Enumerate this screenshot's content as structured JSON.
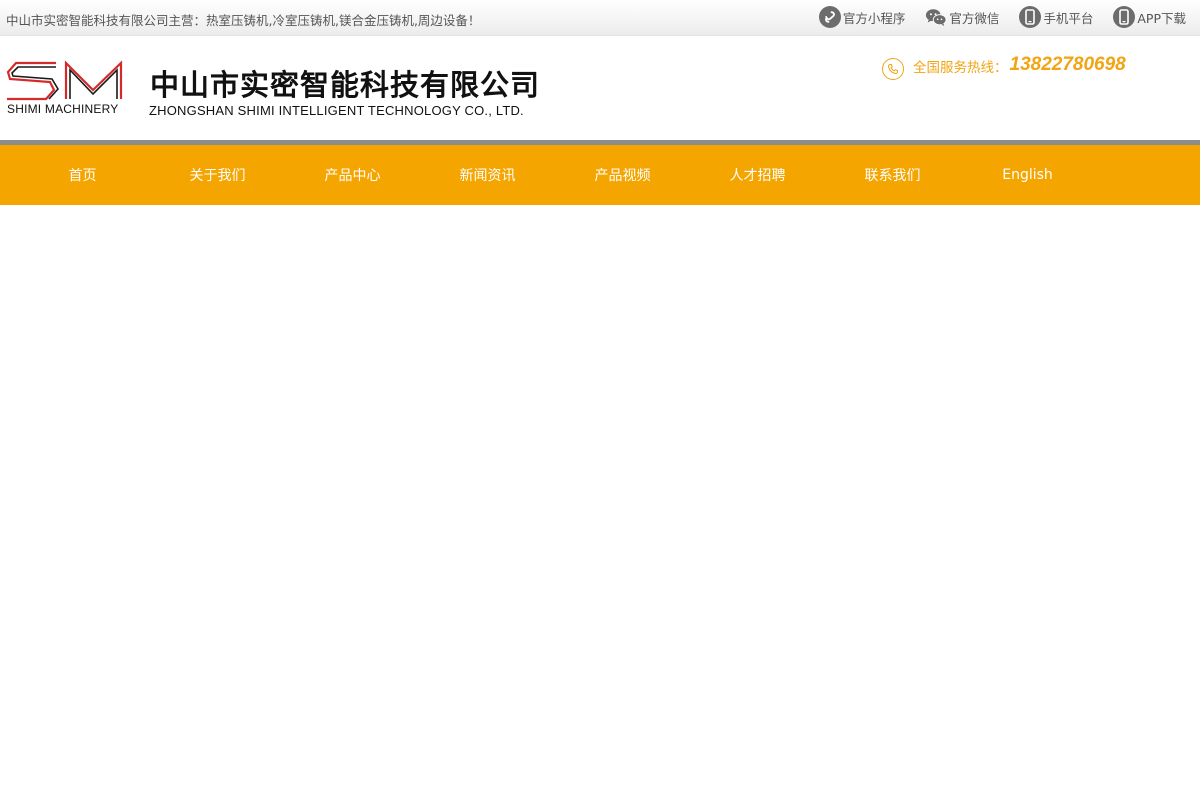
{
  "topbar": {
    "slogan": "中山市实密智能科技有限公司主营：热室压铸机,冷室压铸机,镁合金压铸机,周边设备！",
    "links": [
      {
        "label": "官方小程序",
        "icon": "mini-program-icon"
      },
      {
        "label": "官方微信",
        "icon": "wechat-icon"
      },
      {
        "label": "手机平台",
        "icon": "mobile-icon"
      },
      {
        "label": "APP下载",
        "icon": "mobile-icon"
      }
    ]
  },
  "header": {
    "logo_mark": "SM",
    "logo_sub": "SHIMI MACHINERY",
    "company_cn": "中山市实密智能科技有限公司",
    "company_en": "ZHONGSHAN SHIMI INTELLIGENT TECHNOLOGY CO., LTD.",
    "hotline_label": "全国服务热线：",
    "hotline_number": "13822780698"
  },
  "nav": {
    "items": [
      {
        "label": "首页"
      },
      {
        "label": "关于我们"
      },
      {
        "label": "产品中心"
      },
      {
        "label": "新闻资讯"
      },
      {
        "label": "产品视频"
      },
      {
        "label": "人才招聘"
      },
      {
        "label": "联系我们"
      },
      {
        "label": "English"
      }
    ]
  },
  "colors": {
    "accent": "#f5a500",
    "hotline": "#f2a413",
    "logo_red": "#d42a2a",
    "nav_strip": "#8c8c8c"
  }
}
